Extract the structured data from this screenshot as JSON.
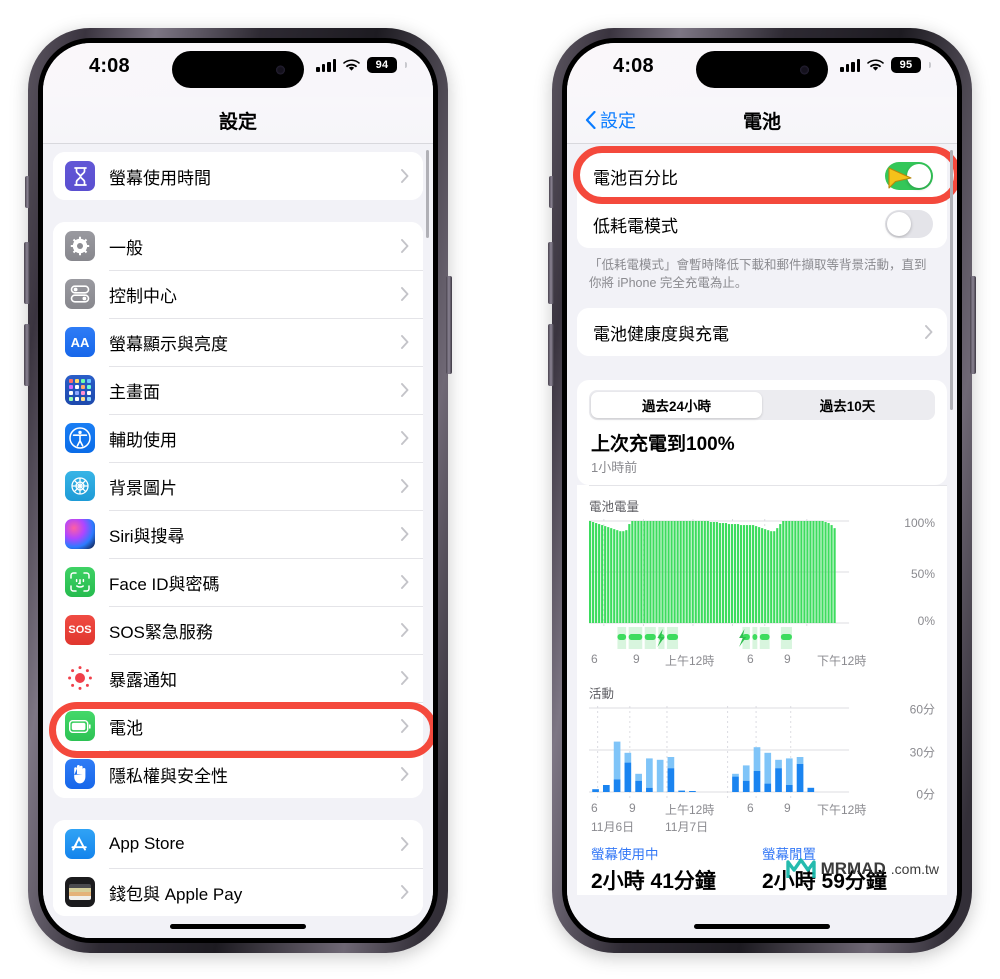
{
  "left_phone": {
    "status_bar": {
      "time": "4:08",
      "battery": "94",
      "wifi_icon": "wifi-icon",
      "cellular_icon": "cellular-signal-icon"
    },
    "nav": {
      "title": "設定"
    },
    "groups": [
      {
        "items": [
          {
            "label": "螢幕使用時間",
            "icon": "hourglass-icon"
          }
        ]
      },
      {
        "items": [
          {
            "label": "一般",
            "icon": "gear-icon"
          },
          {
            "label": "控制中心",
            "icon": "control-center-icon"
          },
          {
            "label": "螢幕顯示與亮度",
            "icon": "aa-text-icon"
          },
          {
            "label": "主畫面",
            "icon": "home-screen-grid-icon"
          },
          {
            "label": "輔助使用",
            "icon": "accessibility-icon"
          },
          {
            "label": "背景圖片",
            "icon": "wallpaper-icon"
          },
          {
            "label": "Siri與搜尋",
            "icon": "siri-orb-icon"
          },
          {
            "label": "Face ID與密碼",
            "icon": "face-id-icon"
          },
          {
            "label": "SOS緊急服務",
            "icon": "sos-icon"
          },
          {
            "label": "暴露通知",
            "icon": "exposure-notification-icon"
          },
          {
            "label": "電池",
            "icon": "battery-icon",
            "highlighted": true
          },
          {
            "label": "隱私權與安全性",
            "icon": "hand-privacy-icon"
          }
        ]
      },
      {
        "items": [
          {
            "label": "App Store",
            "icon": "app-store-icon"
          },
          {
            "label": "錢包與 Apple Pay",
            "icon": "wallet-icon"
          }
        ]
      }
    ]
  },
  "right_phone": {
    "status_bar": {
      "time": "4:08",
      "battery": "95",
      "wifi_icon": "wifi-icon",
      "cellular_icon": "cellular-signal-icon"
    },
    "nav": {
      "back_label": "設定",
      "title": "電池"
    },
    "toggles": [
      {
        "label": "電池百分比",
        "state": "on",
        "highlighted": true,
        "cursor": "arrow-cursor"
      },
      {
        "label": "低耗電模式",
        "state": "off",
        "highlighted": false
      }
    ],
    "footnote": "「低耗電模式」會暫時降低下載和郵件擷取等背景活動，直到你將 iPhone 完全充電為止。",
    "health_row": {
      "label": "電池健康度與充電"
    },
    "segments": [
      {
        "label": "過去24小時",
        "active": true
      },
      {
        "label": "過去10天",
        "active": false
      }
    ],
    "last_charge": {
      "title": "上次充電到100%",
      "subtitle": "1小時前"
    },
    "bottom_stats": [
      {
        "header": "螢幕使用中",
        "value": "2小時 41分鐘"
      },
      {
        "header": "螢幕閒置",
        "value": "2小時 59分鐘"
      }
    ],
    "watermark": {
      "name": "MRMAD",
      "suffix": ".com.tw"
    }
  },
  "chart_data": [
    {
      "type": "area",
      "id": "battery-level-chart",
      "title": "電池電量",
      "xlabel": "",
      "ylabel": "",
      "ylim": [
        0,
        100
      ],
      "ytick_labels": [
        "100%",
        "50%",
        "0%"
      ],
      "ytick_values": [
        100,
        50,
        0
      ],
      "xtick_labels": [
        "6",
        "9",
        "上午12時",
        "6",
        "9",
        "下午12時"
      ],
      "xtick_positions": [
        0.06,
        0.22,
        0.42,
        0.58,
        0.71,
        0.88
      ],
      "grid": true,
      "series": [
        {
          "name": "電池電量",
          "color": "#3ddc5e",
          "values": [
            100,
            99,
            98,
            97,
            96,
            95,
            94,
            93,
            92,
            91,
            90,
            90,
            91,
            97,
            100,
            100,
            100,
            100,
            100,
            100,
            100,
            100,
            100,
            100,
            100,
            100,
            100,
            100,
            100,
            100,
            100,
            100,
            100,
            100,
            100,
            100,
            100,
            100,
            100,
            100,
            99,
            99,
            99,
            98,
            98,
            98,
            97,
            97,
            97,
            97,
            96,
            96,
            96,
            96,
            96,
            95,
            94,
            93,
            92,
            91,
            90,
            90,
            93,
            97,
            100,
            100,
            100,
            100,
            100,
            100,
            100,
            100,
            100,
            100,
            100,
            100,
            100,
            100,
            99,
            98,
            96,
            93
          ]
        }
      ],
      "charging_marks": {
        "color": "#3ddc5e",
        "segments": [
          {
            "start": 0.115,
            "width": 0.035
          },
          {
            "start": 0.16,
            "width": 0.055
          },
          {
            "start": 0.225,
            "width": 0.045
          },
          {
            "start": 0.28,
            "width": 0.025
          },
          {
            "start": 0.315,
            "width": 0.045
          },
          {
            "start": 0.62,
            "width": 0.03
          },
          {
            "start": 0.66,
            "width": 0.02
          },
          {
            "start": 0.69,
            "width": 0.04
          },
          {
            "start": 0.775,
            "width": 0.045
          }
        ],
        "bolt_positions": [
          0.28,
          0.61
        ]
      }
    },
    {
      "type": "bar",
      "id": "activity-chart",
      "title": "活動",
      "xlabel": "",
      "ylabel": "",
      "ylim": [
        0,
        60
      ],
      "ytick_labels": [
        "60分",
        "30分",
        "0分"
      ],
      "ytick_values": [
        60,
        30,
        0
      ],
      "xtick_labels": [
        "6",
        "9",
        "上午12時",
        "6",
        "9",
        "下午12時"
      ],
      "xtick_positions": [
        0.035,
        0.165,
        0.315,
        0.56,
        0.675,
        0.815
      ],
      "day_labels": [
        {
          "text": "11月6日",
          "position": 0.02
        },
        {
          "text": "11月7日",
          "position": 0.295
        }
      ],
      "grid": true,
      "categories": [
        "1",
        "2",
        "3",
        "4",
        "5",
        "6",
        "7",
        "8",
        "9",
        "10",
        "11",
        "12",
        "13",
        "14",
        "15",
        "16",
        "17",
        "18",
        "19",
        "20",
        "21",
        "22",
        "23",
        "24"
      ],
      "series": [
        {
          "name": "螢幕使用中",
          "color": "#1a84f0",
          "values": [
            2,
            5,
            9,
            21,
            8,
            3,
            0,
            17,
            1,
            0.7,
            0,
            0,
            0,
            11,
            8,
            15,
            6,
            17,
            5,
            20,
            3
          ]
        },
        {
          "name": "螢幕閒置",
          "color": "#7fc4f8",
          "values": [
            0,
            0,
            27,
            7,
            5,
            21,
            23,
            8,
            0,
            0,
            0,
            0,
            0,
            2,
            11,
            17,
            22,
            6,
            19,
            5,
            0
          ]
        }
      ]
    }
  ]
}
